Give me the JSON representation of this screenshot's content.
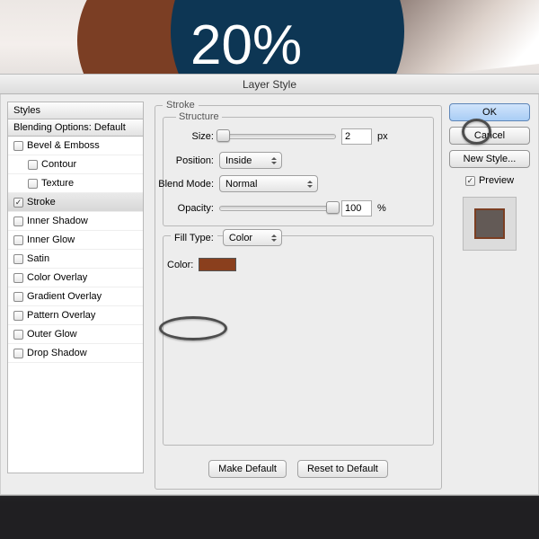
{
  "bg": {
    "percent_text": "20%"
  },
  "dialog": {
    "title": "Layer Style",
    "left": {
      "styles_header": "Styles",
      "blending_header": "Blending Options: Default",
      "items": [
        {
          "label": "Bevel & Emboss",
          "checked": false,
          "indent": 0
        },
        {
          "label": "Contour",
          "checked": false,
          "indent": 1
        },
        {
          "label": "Texture",
          "checked": false,
          "indent": 1
        },
        {
          "label": "Stroke",
          "checked": true,
          "indent": 0,
          "selected": true
        },
        {
          "label": "Inner Shadow",
          "checked": false,
          "indent": 0
        },
        {
          "label": "Inner Glow",
          "checked": false,
          "indent": 0
        },
        {
          "label": "Satin",
          "checked": false,
          "indent": 0
        },
        {
          "label": "Color Overlay",
          "checked": false,
          "indent": 0
        },
        {
          "label": "Gradient Overlay",
          "checked": false,
          "indent": 0
        },
        {
          "label": "Pattern Overlay",
          "checked": false,
          "indent": 0
        },
        {
          "label": "Outer Glow",
          "checked": false,
          "indent": 0
        },
        {
          "label": "Drop Shadow",
          "checked": false,
          "indent": 0
        }
      ]
    },
    "stroke": {
      "group_label": "Stroke",
      "structure_label": "Structure",
      "size_label": "Size:",
      "size_value": "2",
      "size_unit": "px",
      "position_label": "Position:",
      "position_value": "Inside",
      "blend_label": "Blend Mode:",
      "blend_value": "Normal",
      "opacity_label": "Opacity:",
      "opacity_value": "100",
      "opacity_unit": "%",
      "filltype_label": "Fill Type:",
      "filltype_value": "Color",
      "color_label": "Color:",
      "color_hex": "#8a3f1d",
      "make_default": "Make Default",
      "reset_default": "Reset to Default"
    },
    "buttons": {
      "ok": "OK",
      "cancel": "Cancel",
      "new_style": "New Style...",
      "preview_label": "Preview"
    }
  }
}
